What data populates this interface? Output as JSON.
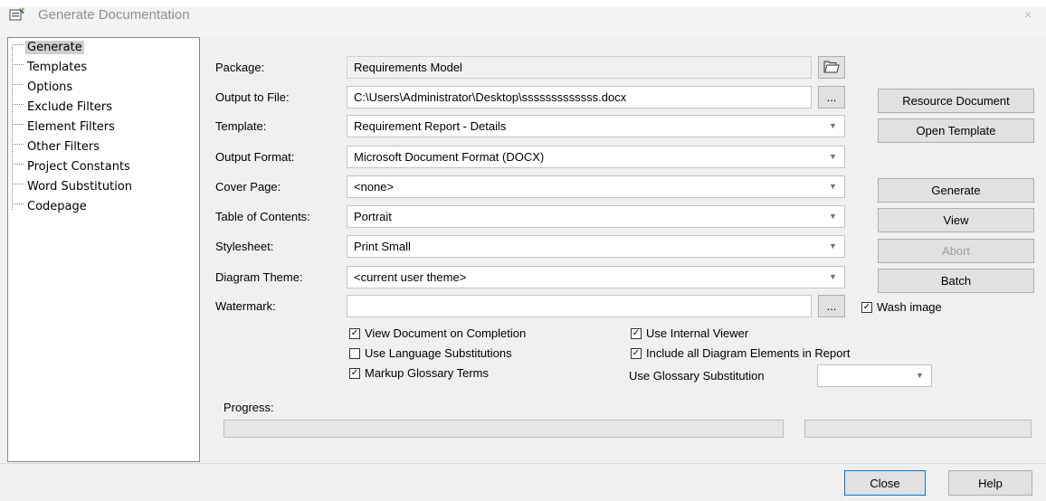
{
  "window": {
    "title": "Generate Documentation",
    "close_glyph": "×",
    "title_icon": "wizard-icon"
  },
  "tree": {
    "items": [
      {
        "label": "Generate",
        "selected": true
      },
      {
        "label": "Templates"
      },
      {
        "label": "Options"
      },
      {
        "label": "Exclude Filters"
      },
      {
        "label": "Element Filters"
      },
      {
        "label": "Other Filters"
      },
      {
        "label": "Project Constants"
      },
      {
        "label": "Word Substitution"
      },
      {
        "label": "Codepage"
      }
    ]
  },
  "form": {
    "package": {
      "label": "Package:",
      "value": "Requirements Model"
    },
    "output_file": {
      "label": "Output to File:",
      "value": "C:\\Users\\Administrator\\Desktop\\sssssssssssss.docx",
      "browse": "..."
    },
    "template": {
      "label": "Template:",
      "value": "Requirement Report - Details"
    },
    "output_format": {
      "label": "Output Format:",
      "value": "Microsoft Document Format (DOCX)"
    },
    "cover_page": {
      "label": "Cover Page:",
      "value": "<none>"
    },
    "toc": {
      "label": "Table of Contents:",
      "value": "Portrait"
    },
    "stylesheet": {
      "label": "Stylesheet:",
      "value": "Print Small"
    },
    "diagram_theme": {
      "label": "Diagram Theme:",
      "value": "<current user theme>"
    },
    "watermark": {
      "label": "Watermark:",
      "value": "",
      "browse": "..."
    },
    "wash_image": {
      "label": "Wash image",
      "checked": true
    }
  },
  "options": {
    "view_doc": {
      "label": "View Document on Completion",
      "checked": true
    },
    "language_subs": {
      "label": "Use Language Substitutions",
      "checked": false
    },
    "markup_glossary": {
      "label": "Markup Glossary Terms",
      "checked": true
    },
    "internal_viewer": {
      "label": "Use Internal Viewer",
      "checked": true
    },
    "include_diagram_elements": {
      "label": "Include all Diagram Elements in Report",
      "checked": true
    },
    "glossary_substitution": {
      "label": "Use Glossary Substitution",
      "value": ""
    }
  },
  "buttons": {
    "resource_document": "Resource Document",
    "open_template": "Open Template",
    "generate": "Generate",
    "view": "View",
    "abort": "Abort",
    "batch": "Batch",
    "close": "Close",
    "help": "Help"
  },
  "progress": {
    "label": "Progress:",
    "value": 0
  },
  "colors": {
    "accent": "#0078d7",
    "panel": "#f0f0f0",
    "border": "#c3c3c3"
  }
}
